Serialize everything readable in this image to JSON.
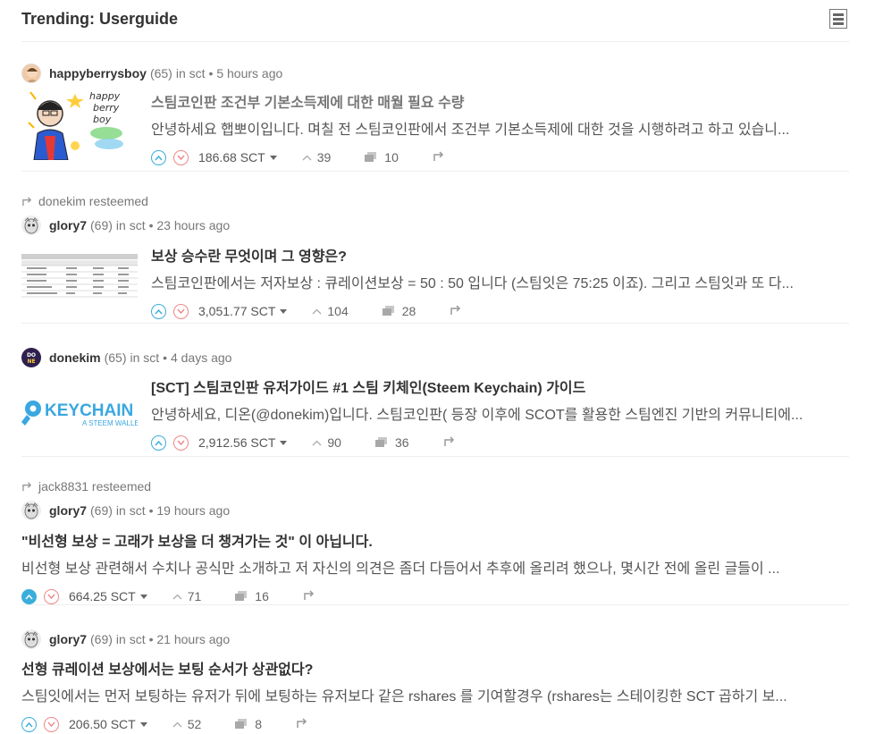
{
  "header": {
    "title": "Trending: Userguide"
  },
  "posts": [
    {
      "resteemed_by": "",
      "author": "happyberrysboy",
      "reputation": "(65)",
      "community": "in sct",
      "time": "• 5 hours ago",
      "title": "스팀코인판 조건부 기본소득제에 대한 매월 필요 수량",
      "excerpt": "안녕하세요 햅뽀이입니다. 며칠 전 스팀코인판에서 조건부 기본소득제에 대한 것을 시행하려고 하고 있습니...",
      "payout": "186.68 SCT",
      "votes": "39",
      "comments": "10",
      "thumbnail": {
        "lines": [
          "happy",
          "berry",
          "boy"
        ]
      }
    },
    {
      "resteemed_by": "donekim resteemed",
      "author": "glory7",
      "reputation": "(69)",
      "community": "in sct",
      "time": "• 23 hours ago",
      "title": "보상 승수란 무엇이며 그 영향은?",
      "excerpt": "스팀코인판에서는 저자보상 : 큐레이션보상 = 50 : 50 입니다 (스팀잇은 75:25 이죠). 그리고 스팀잇과 또 다...",
      "payout": "3,051.77 SCT",
      "votes": "104",
      "comments": "28"
    },
    {
      "resteemed_by": "",
      "author": "donekim",
      "reputation": "(65)",
      "community": "in sct",
      "time": "• 4 days ago",
      "title": "[SCT] 스팀코인판 유저가이드 #1 스팀 키체인(Steem Keychain) 가이드",
      "excerpt": "안녕하세요, 디온(@donekim)입니다. 스팀코인판( 등장 이후에 SCOT를 활용한 스팀엔진 기반의 커뮤니티에...",
      "payout": "2,912.56 SCT",
      "votes": "90",
      "comments": "36",
      "thumbnail": {
        "logo_text": "KEYCHAIN",
        "logo_sub": "A STEEM WALLET"
      },
      "avatar_text": "DO NE"
    },
    {
      "resteemed_by": "jack8831 resteemed",
      "author": "glory7",
      "reputation": "(69)",
      "community": "in sct",
      "time": "• 19 hours ago",
      "title": "\"비선형 보상 = 고래가 보상을 더 챙겨가는 것\" 이 아닙니다.",
      "excerpt": "비선형 보상 관련해서 수치나 공식만 소개하고 저 자신의 의견은 좀더 다듬어서 추후에 올리려 했으나, 몇시간 전에 올린 글들이 ...",
      "payout": "664.25 SCT",
      "votes": "71",
      "comments": "16"
    },
    {
      "resteemed_by": "",
      "author": "glory7",
      "reputation": "(69)",
      "community": "in sct",
      "time": "• 21 hours ago",
      "title": "선형 큐레이션 보상에서는 보팅 순서가 상관없다?",
      "excerpt": "스팀잇에서는 먼저 보팅하는 유저가 뒤에 보팅하는 유저보다 같은 rshares 를 기여할경우 (rshares는 스테이킹한 SCT 곱하기 보...",
      "payout": "206.50 SCT",
      "votes": "52",
      "comments": "8"
    }
  ],
  "colors": {
    "upvote": "#3aaedb",
    "downvote": "#ee8888",
    "keychain": "#3aa7e0"
  }
}
